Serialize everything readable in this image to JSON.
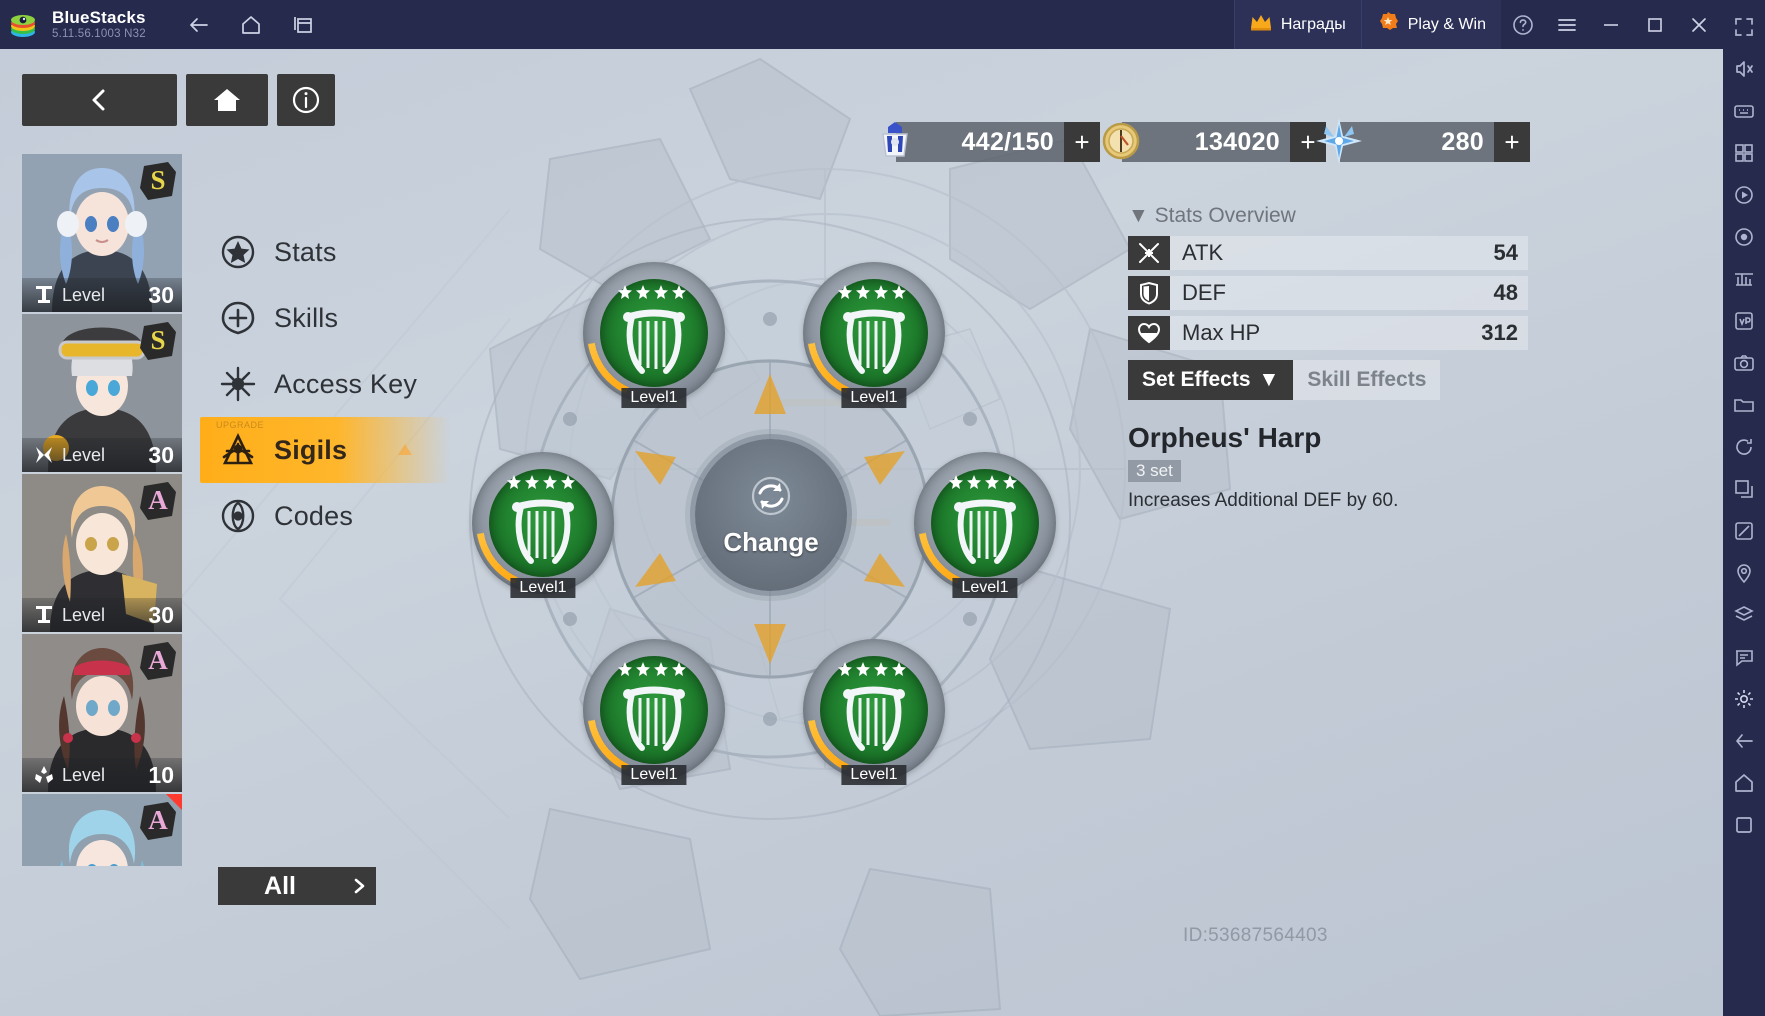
{
  "window": {
    "app_name": "BlueStacks",
    "version": "5.11.56.1003  N32",
    "nav": [
      {
        "name": "back",
        "icon": "arrow-left-icon"
      },
      {
        "name": "home",
        "icon": "home-icon"
      },
      {
        "name": "multi-instance",
        "icon": "windows-icon"
      }
    ],
    "rewards_label": "Награды",
    "playwin_label": "Play & Win",
    "help_icon": "question-circle-icon",
    "menu_icon": "hamburger-icon",
    "minimize_icon": "minimize-icon",
    "maximize_icon": "maximize-icon",
    "close_icon": "close-icon",
    "collapse_icon": "double-chevron-right-icon"
  },
  "rail": [
    "fullscreen-icon",
    "mute-icon",
    "keymap-icon",
    "multi-instance-manager-icon",
    "media-player-icon",
    "macro-record-icon",
    "eco-mode-icon",
    "apk-install-icon",
    "screenshot-icon",
    "folder-icon",
    "rotate-icon",
    "resize-icon",
    "trim-icon",
    "location-icon",
    "layers-icon",
    "chat-icon",
    "settings-icon",
    "back-icon",
    "home-nav-icon",
    "recents-icon"
  ],
  "game": {
    "top_buttons": [
      {
        "name": "back-button",
        "icon": "chevron-left-icon"
      },
      {
        "name": "home-button",
        "icon": "home-solid-icon"
      },
      {
        "name": "info-button",
        "icon": "info-circle-icon"
      }
    ],
    "currencies": [
      {
        "name": "stamina",
        "icon": "stamina-mech-icon",
        "value": "442/150",
        "plus": "+"
      },
      {
        "name": "gold",
        "icon": "gold-coin-icon",
        "value": "134020",
        "plus": "+"
      },
      {
        "name": "crystal",
        "icon": "crystal-star-icon",
        "value": "280",
        "plus": "+"
      }
    ],
    "characters": [
      {
        "rank": "S",
        "rank_color": "#e8d44a",
        "level_label": "Level",
        "level": "30",
        "class_icon": "sniper-class-icon",
        "selected": true,
        "new": false,
        "hair": "#a8c4e8",
        "hair2": "#8fb0da",
        "skin": "#f6e3da",
        "outfit": "#3b4450",
        "bg": "#93a2b3"
      },
      {
        "rank": "S",
        "rank_color": "#e8d44a",
        "level_label": "Level",
        "level": "30",
        "class_icon": "assault-class-icon",
        "selected": false,
        "new": false,
        "hair": "#dcdee2",
        "hair2": "#c3c7cd",
        "skin": "#f7e6dc",
        "outfit": "#3a3a3c",
        "bg": "#8d949c"
      },
      {
        "rank": "A",
        "rank_color": "#e8a8d8",
        "level_label": "Level",
        "level": "30",
        "class_icon": "sniper-class-icon",
        "selected": false,
        "new": false,
        "hair": "#f0c896",
        "hair2": "#d9a86e",
        "skin": "#f8e7d9",
        "outfit": "#2f2f33",
        "bg": "#8e8b86"
      },
      {
        "rank": "A",
        "rank_color": "#e8a8d8",
        "level_label": "Level",
        "level": "10",
        "class_icon": "support-class-icon",
        "selected": false,
        "new": false,
        "hair": "#6b4a40",
        "hair2": "#53372f",
        "skin": "#f6e2d6",
        "outfit": "#2a2a2c",
        "bg": "#8f8c8a"
      },
      {
        "rank": "A",
        "rank_color": "#e8a8d8",
        "level_label": "Level",
        "level": "",
        "class_icon": "support-class-icon",
        "selected": false,
        "new": true,
        "hair": "#9fd3ea",
        "hair2": "#7fbcd9",
        "skin": "#f7e6de",
        "outfit": "#33404d",
        "bg": "#90a0af"
      }
    ],
    "menu": [
      {
        "label": "Stats",
        "icon": "star-circle-icon",
        "active": false,
        "badge": ""
      },
      {
        "label": "Skills",
        "icon": "plus-circle-icon",
        "active": false,
        "badge": ""
      },
      {
        "label": "Access Key",
        "icon": "access-key-icon",
        "active": false,
        "badge": ""
      },
      {
        "label": "Sigils",
        "icon": "sigil-icon",
        "active": true,
        "badge": "UPGRADE"
      },
      {
        "label": "Codes",
        "icon": "codes-target-icon",
        "active": false,
        "badge": ""
      }
    ],
    "filter_button": {
      "label": "All",
      "icon": "chevron-right-icon"
    },
    "change_button": {
      "label": "Change",
      "icon": "refresh-circle-icon"
    },
    "sigil_slots": [
      {
        "position": "top-left",
        "level_label": "Level1",
        "stars": 4,
        "icon": "harp-sigil-icon",
        "rarity_color": "#1d7a2b"
      },
      {
        "position": "top-right",
        "level_label": "Level1",
        "stars": 4,
        "icon": "harp-sigil-icon",
        "rarity_color": "#1d7a2b"
      },
      {
        "position": "mid-left",
        "level_label": "Level1",
        "stars": 4,
        "icon": "harp-sigil-icon",
        "rarity_color": "#1d7a2b"
      },
      {
        "position": "mid-right",
        "level_label": "Level1",
        "stars": 4,
        "icon": "harp-sigil-icon",
        "rarity_color": "#1d7a2b"
      },
      {
        "position": "bottom-left",
        "level_label": "Level1",
        "stars": 4,
        "icon": "harp-sigil-icon",
        "rarity_color": "#1d7a2b"
      },
      {
        "position": "bottom-right",
        "level_label": "Level1",
        "stars": 4,
        "icon": "harp-sigil-icon",
        "rarity_color": "#1d7a2b"
      }
    ],
    "stats_panel": {
      "title": "Stats Overview",
      "collapse_icon": "triangle-down-icon",
      "rows": [
        {
          "icon": "atk-swords-icon",
          "label": "ATK",
          "value": "54"
        },
        {
          "icon": "def-shield-icon",
          "label": "DEF",
          "value": "48"
        },
        {
          "icon": "hp-heart-icon",
          "label": "Max HP",
          "value": "312"
        }
      ],
      "tabs": [
        {
          "label": "Set Effects",
          "active": true,
          "caret": "▼"
        },
        {
          "label": "Skill Effects",
          "active": false,
          "caret": ""
        }
      ],
      "set_name": "Orpheus' Harp",
      "set_count": "3 set",
      "set_description": "Increases Additional DEF by 60."
    },
    "watermark": "ID:53687564403"
  },
  "colors": {
    "accent_orange": "#ffae19",
    "titlebar": "#262a4d",
    "panel_dark": "#3a3a3a",
    "sigil_green": "#1d7a2b"
  }
}
